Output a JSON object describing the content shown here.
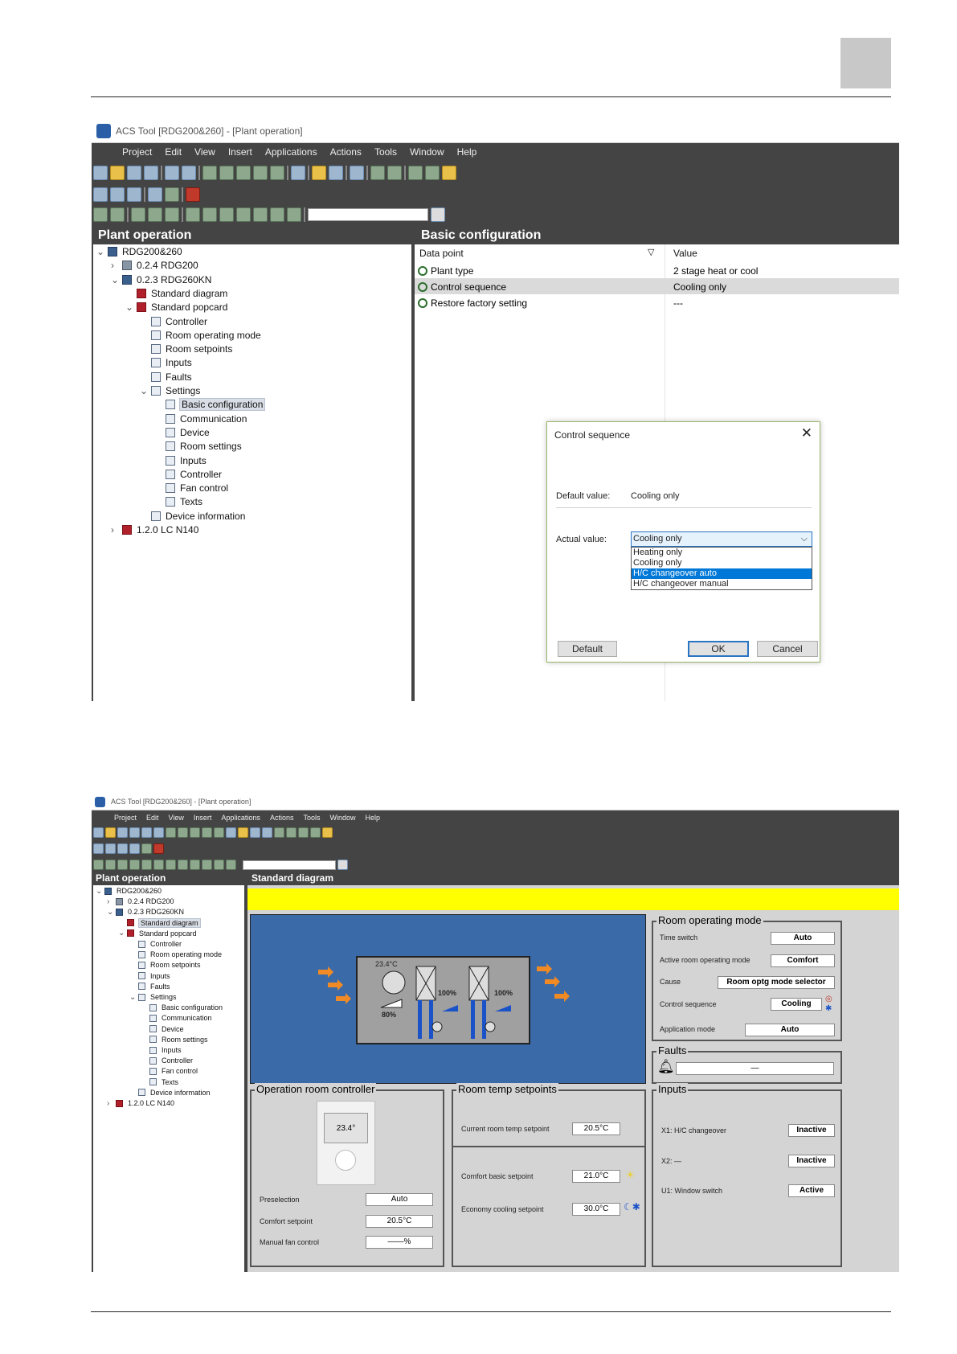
{
  "app": {
    "window_title": "ACS Tool [RDG200&260] - [Plant operation]",
    "menu": [
      "Project",
      "Edit",
      "View",
      "Insert",
      "Applications",
      "Actions",
      "Tools",
      "Window",
      "Help"
    ]
  },
  "tree": [
    {
      "label": "RDG200&260",
      "icon": "network-icon",
      "level": 0,
      "chevron": "v"
    },
    {
      "label": "0.2.4 RDG200",
      "icon": "server-icon",
      "level": 1,
      "chevron": ">"
    },
    {
      "label": "0.2.3  RDG260KN",
      "icon": "device-icon",
      "level": 1,
      "chevron": "v"
    },
    {
      "label": "Standard diagram",
      "icon": "diagram-icon",
      "level": 2,
      "chevron": ""
    },
    {
      "label": "Standard popcard",
      "icon": "popcard-icon",
      "level": 2,
      "chevron": "v"
    },
    {
      "label": "Controller",
      "icon": "page-icon",
      "level": 3,
      "chevron": ""
    },
    {
      "label": "Room operating mode",
      "icon": "page-icon",
      "level": 3,
      "chevron": ""
    },
    {
      "label": "Room setpoints",
      "icon": "page-icon",
      "level": 3,
      "chevron": ""
    },
    {
      "label": "Inputs",
      "icon": "page-icon",
      "level": 3,
      "chevron": ""
    },
    {
      "label": "Faults",
      "icon": "page-icon",
      "level": 3,
      "chevron": ""
    },
    {
      "label": "Settings",
      "icon": "page-icon",
      "level": 3,
      "chevron": "v"
    },
    {
      "label": "Basic configuration",
      "icon": "page-icon",
      "level": 4,
      "chevron": ""
    },
    {
      "label": "Communication",
      "icon": "page-icon",
      "level": 4,
      "chevron": ""
    },
    {
      "label": "Device",
      "icon": "page-icon",
      "level": 4,
      "chevron": ""
    },
    {
      "label": "Room settings",
      "icon": "page-icon",
      "level": 4,
      "chevron": ""
    },
    {
      "label": "Inputs",
      "icon": "page-icon",
      "level": 4,
      "chevron": ""
    },
    {
      "label": "Controller",
      "icon": "page-icon",
      "level": 4,
      "chevron": ""
    },
    {
      "label": "Fan control",
      "icon": "page-icon",
      "level": 4,
      "chevron": ""
    },
    {
      "label": "Texts",
      "icon": "page-icon",
      "level": 4,
      "chevron": ""
    },
    {
      "label": "Device information",
      "icon": "page-icon",
      "level": 3,
      "chevron": ""
    },
    {
      "label": "1.2.0  LC N140",
      "icon": "lc-icon",
      "level": 1,
      "chevron": ">"
    }
  ],
  "s1": {
    "left_title": "Plant operation",
    "right_title": "Basic configuration",
    "col_datapoint": "Data point",
    "col_value": "Value",
    "rows": [
      {
        "dp": "Plant type",
        "val": "2 stage heat or cool"
      },
      {
        "dp": "Control sequence",
        "val": "Cooling only"
      },
      {
        "dp": "Restore factory setting",
        "val": "---"
      }
    ],
    "dialog": {
      "title": "Control sequence",
      "default_label": "Default value:",
      "default_value": "Cooling only",
      "actual_label": "Actual value:",
      "actual_value": "Cooling only",
      "options": [
        "Heating only",
        "Cooling only",
        "H/C changeover auto",
        "H/C changeover manual"
      ],
      "highlighted": "H/C changeover auto",
      "btn_default": "Default",
      "btn_ok": "OK",
      "btn_cancel": "Cancel"
    }
  },
  "s2": {
    "left_title": "Plant operation",
    "right_title": "Standard diagram",
    "diagram": {
      "temp": "23.4°C",
      "valve1": "100%",
      "valve2": "100%",
      "fan": "80%"
    },
    "room_mode": {
      "title": "Room operating mode",
      "rows": [
        {
          "label": "Time switch",
          "value": "Auto"
        },
        {
          "label": "Active room operating mode",
          "value": "Comfort"
        },
        {
          "label": "Cause",
          "value": "Room optg mode selector"
        },
        {
          "label": "Control sequence",
          "value": "Cooling"
        },
        {
          "label": "Application mode",
          "value": "Auto"
        }
      ]
    },
    "faults": {
      "title": "Faults",
      "value": "—"
    },
    "op_ctrl": {
      "title": "Operation room controller",
      "display": "23.4°",
      "rows": [
        {
          "label": "Preselection",
          "value": "Auto"
        },
        {
          "label": "Comfort setpoint",
          "value": "20.5°C"
        },
        {
          "label": "Manual fan control",
          "value": "——%"
        }
      ]
    },
    "setpoints": {
      "title": "Room temp setpoints",
      "current_label": "Current room temp setpoint",
      "current_value": "20.5°C",
      "comfort_label": "Comfort basic setpoint",
      "comfort_value": "21.0°C",
      "economy_label": "Economy cooling setpoint",
      "economy_value": "30.0°C"
    },
    "inputs": {
      "title": "Inputs",
      "rows": [
        {
          "label": "X1:  H/C changeover",
          "value": "Inactive"
        },
        {
          "label": "X2:  —",
          "value": "Inactive"
        },
        {
          "label": "U1:  Window switch",
          "value": "Active"
        }
      ]
    }
  },
  "colors": {
    "toolbar_dark": "#444444",
    "diagram_blue": "#3a6aa8",
    "yellow_bar": "#ffff00",
    "selection": "#0078d7"
  }
}
